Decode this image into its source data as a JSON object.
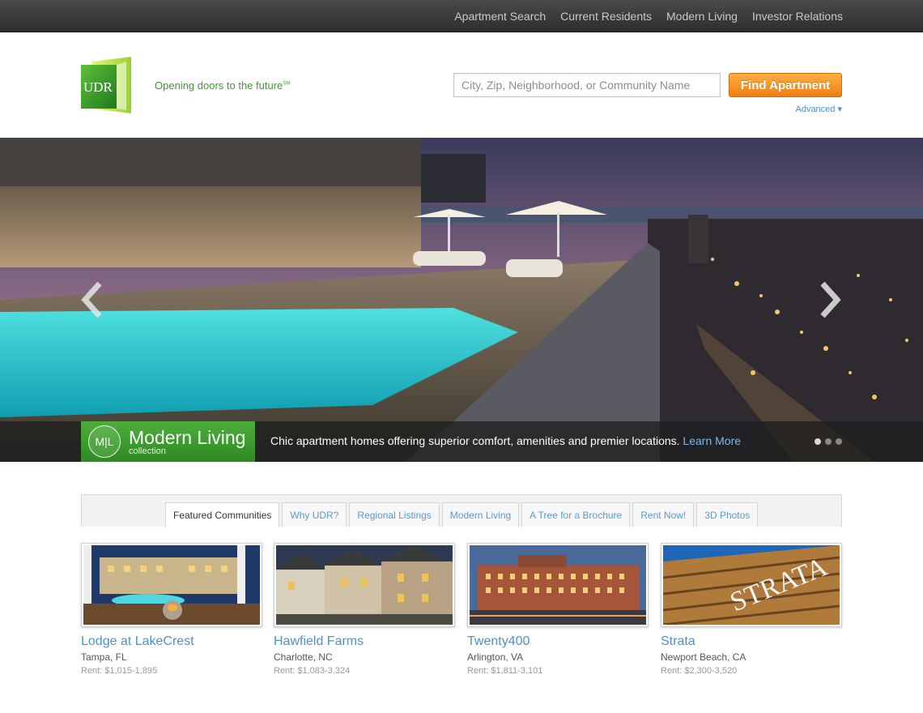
{
  "top_nav": {
    "items": [
      "Apartment Search",
      "Current Residents",
      "Modern Living",
      "Investor Relations"
    ]
  },
  "header": {
    "logo_text": "UDR",
    "tagline": "Opening doors to the future",
    "tagline_mark": "SM",
    "search_placeholder": "City, Zip, Neighborhood, or Community Name",
    "find_button": "Find Apartment",
    "advanced_link": "Advanced ▾"
  },
  "hero": {
    "badge_monogram": "M|L",
    "badge_title_a": "Modern ",
    "badge_title_b": "Living",
    "badge_subtitle": "collection",
    "caption": "Chic apartment homes offering superior comfort, amenities and premier locations. ",
    "caption_link": "Learn More",
    "slide_count": 3,
    "active_slide": 1,
    "prev_icon": "chevron-left",
    "next_icon": "chevron-right"
  },
  "tabs": {
    "items": [
      "Featured Communities",
      "Why UDR?",
      "Regional Listings",
      "Modern Living",
      "A Tree for a Brochure",
      "Rent Now!",
      "3D Photos"
    ],
    "active_index": 0
  },
  "communities": [
    {
      "name": "Lodge at LakeCrest",
      "city": "Tampa, FL",
      "rent": "Rent: $1,015-1,895"
    },
    {
      "name": "Hawfield Farms",
      "city": "Charlotte, NC",
      "rent": "Rent: $1,083-3,324"
    },
    {
      "name": "Twenty400",
      "city": "Arlington, VA",
      "rent": "Rent: $1,811-3,101"
    },
    {
      "name": "Strata",
      "city": "Newport Beach, CA",
      "rent": "Rent: $2,300-3,520",
      "sign_text": "STRATA"
    }
  ],
  "colors": {
    "accent_blue": "#4d93c9",
    "brand_green": "#3e9a2f",
    "button_orange": "#f07e12"
  }
}
